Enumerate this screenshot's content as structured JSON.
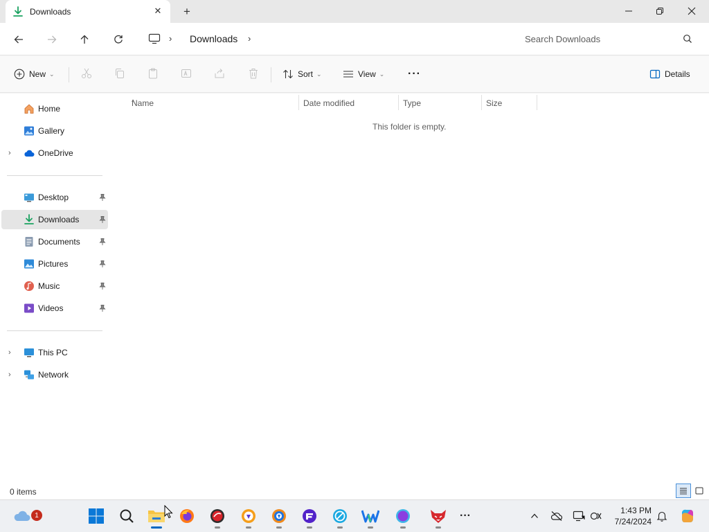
{
  "window": {
    "tab_title": "Downloads",
    "new_tab": "+",
    "close_tab": "✕"
  },
  "address": {
    "crumbs": [
      "Downloads"
    ],
    "search_placeholder": "Search Downloads"
  },
  "command_bar": {
    "new_label": "New",
    "sort_label": "Sort",
    "view_label": "View",
    "more_label": "···",
    "details_label": "Details"
  },
  "nav": {
    "top_items": [
      {
        "label": "Home",
        "icon": "home-icon"
      },
      {
        "label": "Gallery",
        "icon": "gallery-icon"
      },
      {
        "label": "OneDrive",
        "icon": "cloud-icon"
      }
    ],
    "quick_access": [
      {
        "label": "Desktop",
        "icon": "desktop-icon",
        "pinned": true
      },
      {
        "label": "Downloads",
        "icon": "download-icon",
        "pinned": true,
        "selected": true
      },
      {
        "label": "Documents",
        "icon": "document-icon",
        "pinned": true
      },
      {
        "label": "Pictures",
        "icon": "pictures-icon",
        "pinned": true
      },
      {
        "label": "Music",
        "icon": "music-icon",
        "pinned": true
      },
      {
        "label": "Videos",
        "icon": "videos-icon",
        "pinned": true
      }
    ],
    "bottom_items": [
      {
        "label": "This PC",
        "icon": "pc-icon"
      },
      {
        "label": "Network",
        "icon": "network-icon"
      }
    ]
  },
  "content": {
    "columns": [
      "Name",
      "Date modified",
      "Type",
      "Size"
    ],
    "empty_message": "This folder is empty."
  },
  "status": {
    "item_count": "0 items"
  },
  "taskbar": {
    "weather_badge": "1",
    "time": "1:43 PM",
    "date": "7/24/2024",
    "more": "···"
  },
  "colors": {
    "accent": "#0067c0",
    "download_green": "#1aa260",
    "folder_yellow": "#f6c343"
  }
}
